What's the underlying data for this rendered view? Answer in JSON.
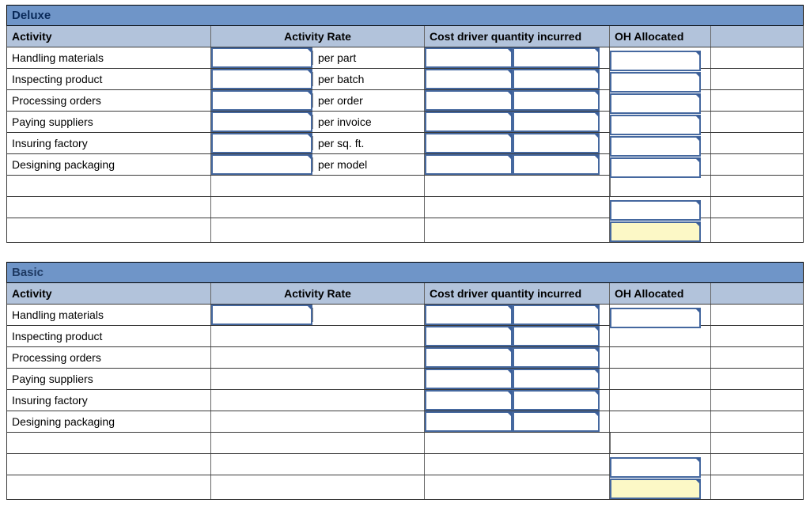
{
  "sections": [
    {
      "title": "Deluxe",
      "headers": {
        "activity": "Activity",
        "rate": "Activity Rate",
        "cost": "Cost driver quantity incurred",
        "oh": "OH Allocated",
        "blank": ""
      },
      "rows": [
        {
          "activity": "Handling materials",
          "rate_value": "",
          "rate_unit": "per part",
          "cost_a": "",
          "cost_b": "",
          "oh": ""
        },
        {
          "activity": "Inspecting product",
          "rate_value": "",
          "rate_unit": "per batch",
          "cost_a": "",
          "cost_b": "",
          "oh": ""
        },
        {
          "activity": "Processing orders",
          "rate_value": "",
          "rate_unit": "per order",
          "cost_a": "",
          "cost_b": "",
          "oh": ""
        },
        {
          "activity": "Paying suppliers",
          "rate_value": "",
          "rate_unit": "per invoice",
          "cost_a": "",
          "cost_b": "",
          "oh": ""
        },
        {
          "activity": "Insuring factory",
          "rate_value": "",
          "rate_unit": "per sq. ft.",
          "cost_a": "",
          "cost_b": "",
          "oh": ""
        },
        {
          "activity": "Designing packaging",
          "rate_value": "",
          "rate_unit": "per model",
          "cost_a": "",
          "cost_b": "",
          "oh": ""
        }
      ],
      "subtotal": "",
      "total": ""
    },
    {
      "title": "Basic",
      "headers": {
        "activity": "Activity",
        "rate": "Activity Rate",
        "cost": "Cost driver quantity incurred",
        "oh": "OH Allocated",
        "blank": ""
      },
      "rows": [
        {
          "activity": "Handling materials",
          "rate_value": "",
          "rate_unit": "",
          "cost_a": "",
          "cost_b": "",
          "oh": ""
        },
        {
          "activity": "Inspecting product",
          "rate_value": "",
          "rate_unit": "",
          "cost_a": "",
          "cost_b": "",
          "oh": ""
        },
        {
          "activity": "Processing orders",
          "rate_value": "",
          "rate_unit": "",
          "cost_a": "",
          "cost_b": "",
          "oh": ""
        },
        {
          "activity": "Paying suppliers",
          "rate_value": "",
          "rate_unit": "",
          "cost_a": "",
          "cost_b": "",
          "oh": ""
        },
        {
          "activity": "Insuring factory",
          "rate_value": "",
          "rate_unit": "",
          "cost_a": "",
          "cost_b": "",
          "oh": ""
        },
        {
          "activity": "Designing packaging",
          "rate_value": "",
          "rate_unit": "",
          "cost_a": "",
          "cost_b": "",
          "oh": ""
        }
      ],
      "subtotal": "",
      "total": ""
    }
  ]
}
